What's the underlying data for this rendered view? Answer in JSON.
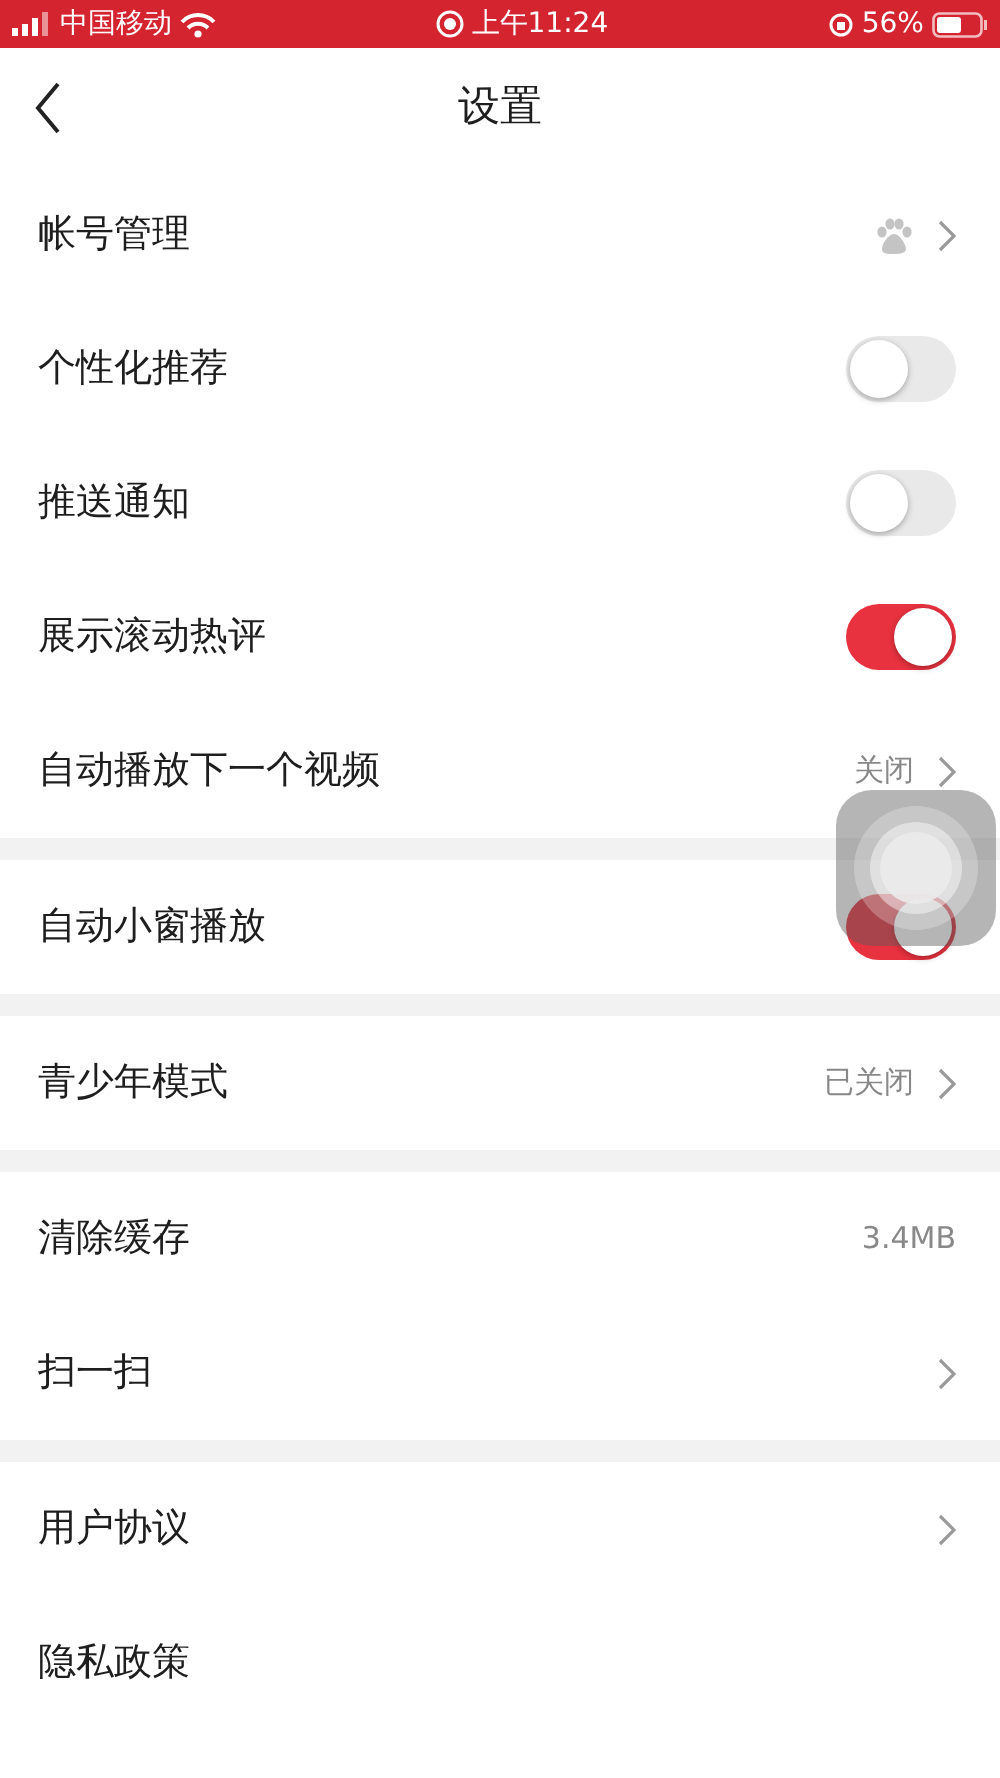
{
  "status_bar": {
    "carrier": "中国移动",
    "time": "上午11:24",
    "battery": "56%"
  },
  "nav": {
    "title": "设置"
  },
  "groups": [
    {
      "items": [
        {
          "kind": "account",
          "label": "帐号管理"
        },
        {
          "kind": "toggle",
          "label": "个性化推荐",
          "on": false
        },
        {
          "kind": "toggle",
          "label": "推送通知",
          "on": false
        },
        {
          "kind": "toggle",
          "label": "展示滚动热评",
          "on": true
        },
        {
          "kind": "link",
          "label": "自动播放下一个视频",
          "value": "关闭"
        }
      ]
    },
    {
      "items": [
        {
          "kind": "toggle",
          "label": "自动小窗播放",
          "on": true
        }
      ]
    },
    {
      "items": [
        {
          "kind": "link",
          "label": "青少年模式",
          "value": "已关闭"
        }
      ]
    },
    {
      "items": [
        {
          "kind": "value",
          "label": "清除缓存",
          "value": "3.4MB"
        },
        {
          "kind": "link",
          "label": "扫一扫"
        }
      ]
    },
    {
      "items": [
        {
          "kind": "link",
          "label": "用户协议"
        },
        {
          "kind": "value",
          "label": "隐私政策"
        }
      ]
    }
  ]
}
